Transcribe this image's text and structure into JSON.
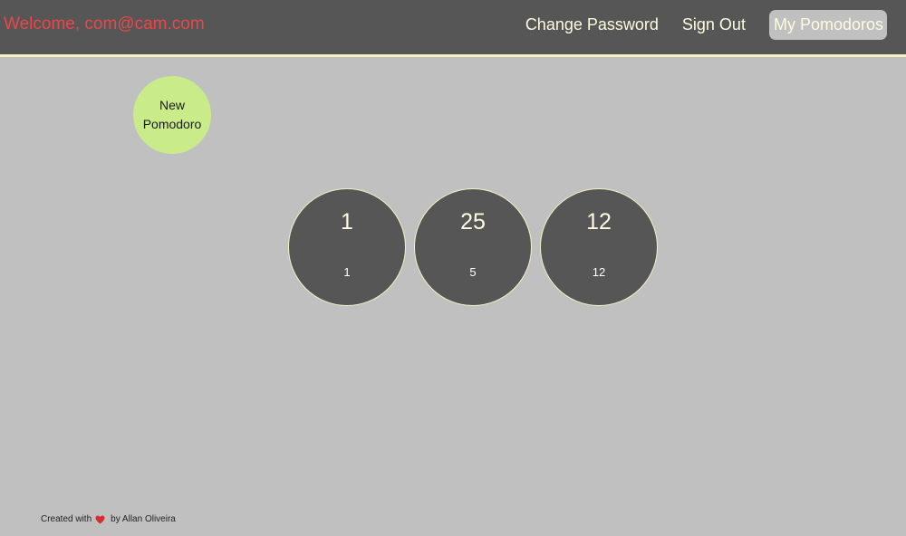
{
  "header": {
    "welcome": "Welcome, com@cam.com",
    "nav": [
      {
        "label": "Change Password"
      },
      {
        "label": "Sign Out"
      },
      {
        "label": "My Pomodoros"
      }
    ]
  },
  "new_button": {
    "line1": "New",
    "line2": "Pomodoro"
  },
  "pomodoros": [
    {
      "value": "1",
      "sub": "1"
    },
    {
      "value": "25",
      "sub": "5"
    },
    {
      "value": "12",
      "sub": "12"
    }
  ],
  "footer": {
    "prefix": "Created with",
    "icon": "heart-icon",
    "suffix": "by Allan Oliveira"
  },
  "colors": {
    "background": "#c0c0c0",
    "header": "#565656",
    "welcome_text": "#e8474b",
    "accent_line": "#f4f0c4",
    "new_button": "#caeb8a",
    "heart": "#d32f2f"
  }
}
